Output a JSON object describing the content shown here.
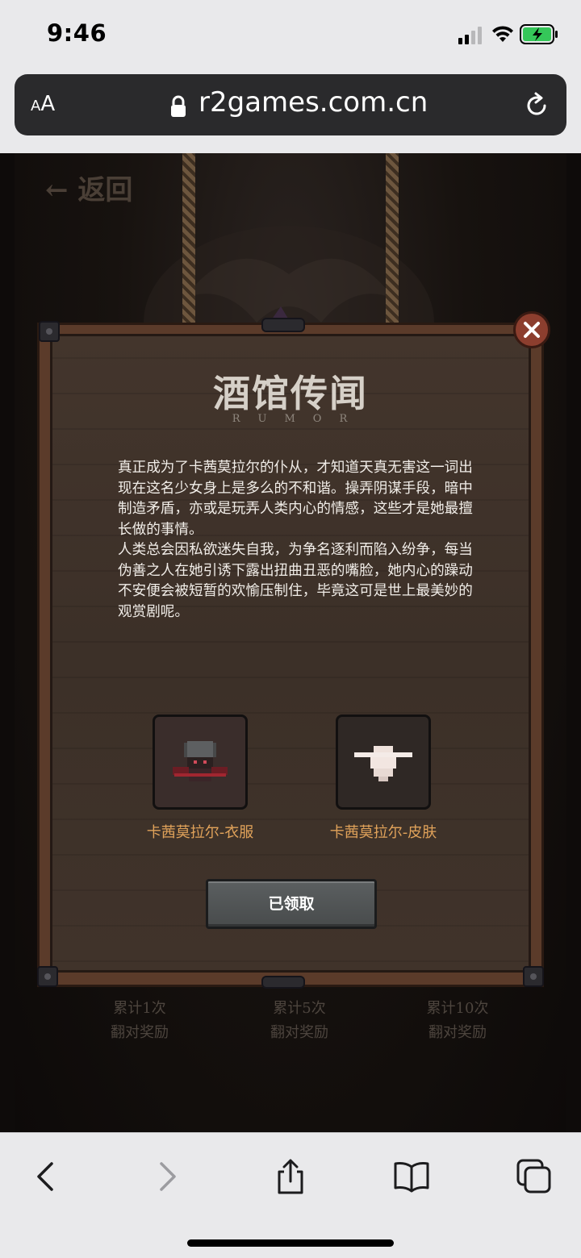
{
  "status_bar": {
    "time": "9:46"
  },
  "browser": {
    "text_size_label_small": "A",
    "text_size_label_large": "A",
    "url": "r2games.com.cn"
  },
  "background": {
    "back_label": "← 返回",
    "stats": [
      {
        "line1": "累计1次",
        "line2": "翻对奖励"
      },
      {
        "line1": "累计5次",
        "line2": "翻对奖励"
      },
      {
        "line1": "累计10次",
        "line2": "翻对奖励"
      }
    ]
  },
  "modal": {
    "title": "酒馆传闻",
    "subtitle": "RUMOR",
    "paragraph1": "真正成为了卡茜莫拉尔的仆从，才知道天真无害这一词出现在这名少女身上是多么的不和谐。操弄阴谋手段，暗中制造矛盾，亦或是玩弄人类内心的情感，这些才是她最擅长做的事情。",
    "paragraph2": "人类总会因私欲迷失自我，为争名逐利而陷入纷争，每当伪善之人在她引诱下露出扭曲丑恶的嘴脸，她内心的躁动不安便会被短暂的欢愉压制住，毕竟这可是世上最美妙的观赏剧呢。",
    "rewards": [
      {
        "label": "卡茜莫拉尔-衣服",
        "icon": "clothes-icon"
      },
      {
        "label": "卡茜莫拉尔-皮肤",
        "icon": "skin-hat-icon"
      }
    ],
    "claimed_button_label": "已领取"
  },
  "colors": {
    "reward_label": "#e1a35a",
    "board": "#3c3028",
    "frame": "#5b3b2a",
    "close_button": "#8c3e2e"
  }
}
